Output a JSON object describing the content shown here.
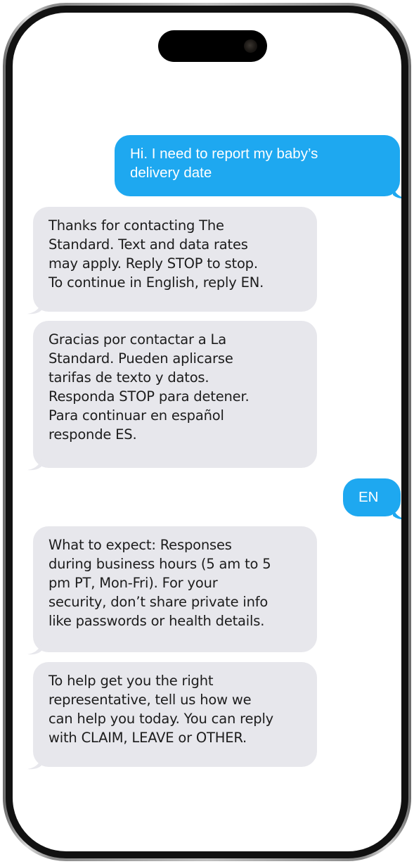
{
  "conversation": {
    "messages": [
      {
        "sender": "user",
        "text": "Hi. I need to report my baby’s\ndelivery date"
      },
      {
        "sender": "business",
        "text": "Thanks for contacting The\nStandard. Text and data rates\nmay apply. Reply STOP to stop.\nTo continue in English, reply EN."
      },
      {
        "sender": "business",
        "text": "Gracias por contactar a La\nStandard. Pueden aplicarse\ntarifas de texto y datos.\nResponda STOP para detener.\nPara continuar en español\nresponde ES."
      },
      {
        "sender": "user",
        "text": "EN"
      },
      {
        "sender": "business",
        "text": "What to expect: Responses\nduring business hours (5 am to 5\npm PT, Mon-Fri). For your\nsecurity, don’t share private info\nlike passwords or health details."
      },
      {
        "sender": "business",
        "text": "To help get you the right\nrepresentative, tell us how we\ncan help you today. You can reply\nwith CLAIM, LEAVE or OTHER."
      }
    ]
  },
  "colors": {
    "outgoing_bubble": "#1ea8f0",
    "incoming_bubble": "#e7e7ec"
  }
}
